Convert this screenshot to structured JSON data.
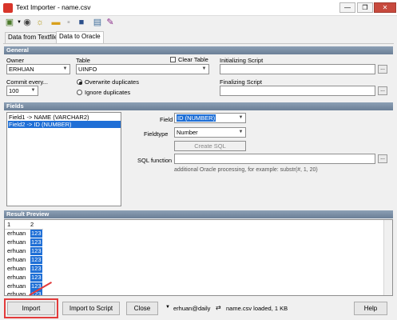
{
  "window": {
    "title": "Text Importer - name.csv",
    "min": "—",
    "max": "❐",
    "close": "✕"
  },
  "toolbar": {
    "icons": [
      "open-icon",
      "dropdown-icon",
      "database-icon",
      "lightbulb-icon",
      "folder-icon",
      "save-disabled-icon",
      "save-icon",
      "table-icon",
      "wand-icon"
    ]
  },
  "tabs": [
    {
      "label": "Data from Textfile"
    },
    {
      "label": "Data to Oracle"
    }
  ],
  "general": {
    "header": "General",
    "owner_label": "Owner",
    "owner_value": "ERHUAN",
    "table_label": "Table",
    "table_value": "UINFO",
    "clear_table_label": "Clear Table",
    "init_script_label": "Initializing Script",
    "commit_label": "Commit every...",
    "commit_value": "100",
    "overwrite_label": "Overwrite duplicates",
    "ignore_label": "Ignore duplicates",
    "final_script_label": "Finalizing Script",
    "dots": "..."
  },
  "fields": {
    "header": "Fields",
    "list": [
      "Field1  ->  NAME (VARCHAR2)",
      "Field2  ->  ID (NUMBER)"
    ],
    "field_label": "Field",
    "field_value": "ID (NUMBER)",
    "fieldtype_label": "Fieldtype",
    "fieldtype_value": "Number",
    "create_sql_label": "Create SQL",
    "sql_function_label": "SQL function",
    "sql_hint": "additional Oracle processing, for example: substr(#, 1, 20)",
    "dots": "..."
  },
  "preview": {
    "header": "Result Preview",
    "columns": [
      "1",
      "2"
    ],
    "rows": [
      [
        "erhuan",
        "123"
      ],
      [
        "erhuan",
        "123"
      ],
      [
        "erhuan",
        "123"
      ],
      [
        "erhuan",
        "123"
      ],
      [
        "erhuan",
        "123"
      ],
      [
        "erhuan",
        "123"
      ],
      [
        "erhuan",
        "123"
      ],
      [
        "erhuan",
        "123"
      ]
    ]
  },
  "bottom": {
    "import_label": "Import",
    "import_script_label": "Import to Script",
    "close_label": "Close",
    "connection_label": "erhuan@daily",
    "status_text": "name.csv loaded, 1 KB",
    "help_label": "Help"
  },
  "colors": {
    "selection": "#1f6fd6",
    "section_header": "#7a8da4",
    "highlight": "#e23b3b"
  }
}
